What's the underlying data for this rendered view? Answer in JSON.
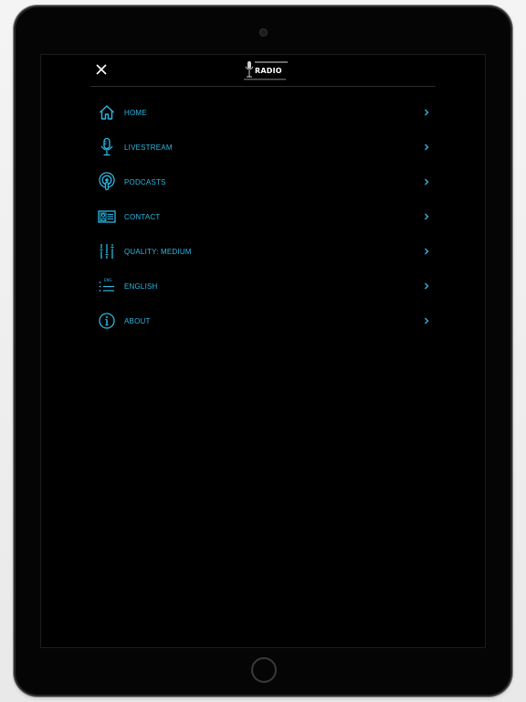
{
  "header": {
    "logo_text": "RADIO",
    "close_icon": "close-icon",
    "logo_icon": "microphone-logo-icon"
  },
  "menu": {
    "items": [
      {
        "label": "HOME",
        "icon": "home-icon"
      },
      {
        "label": "LIVESTREAM",
        "icon": "microphone-icon"
      },
      {
        "label": "PODCASTS",
        "icon": "podcast-icon"
      },
      {
        "label": "CONTACT",
        "icon": "contact-card-icon"
      },
      {
        "label": "QUALITY: MEDIUM",
        "icon": "equalizer-icon"
      },
      {
        "label": "ENGLISH",
        "icon": "language-list-icon"
      },
      {
        "label": "ABOUT",
        "icon": "info-icon"
      }
    ]
  },
  "colors": {
    "accent": "#2bb7e3",
    "background": "#000000"
  }
}
